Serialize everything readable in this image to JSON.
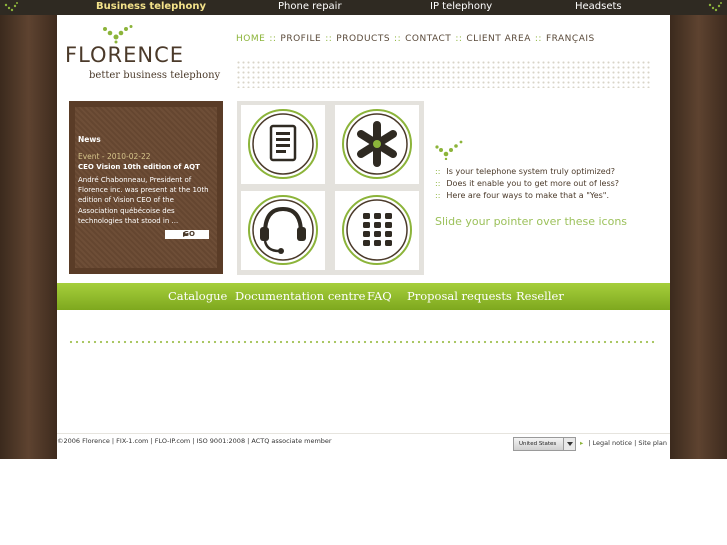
{
  "topbar": {
    "items": [
      "Business telephony",
      "Phone repair",
      "IP telephony",
      "Headsets"
    ]
  },
  "logo": {
    "name": "FLORENCE",
    "tagline": "better business telephony"
  },
  "nav": {
    "items": [
      "HOME",
      "PROFILE",
      "PRODUCTS",
      "CONTACT",
      "CLIENT AREA",
      "FRANÇAIS"
    ],
    "separator": "::"
  },
  "news": {
    "heading": "News",
    "event": "Event - 2010-02-22",
    "title": "CEO Vision 10th edition of AQT",
    "body": "André Chabonneau, President of Florence inc. was present at the 10th edition of Vision CEO of the Association québécoise des technologies that stood in ...",
    "go_label": "GO"
  },
  "icons": [
    "document-icon",
    "asterisk-icon",
    "headset-icon",
    "keypad-icon"
  ],
  "promo": {
    "bullet": "::",
    "lines": [
      "Is your telephone system truly optimized?",
      "Does it enable you to get more out of less?",
      "Here are four ways to make that a \"Yes\"."
    ],
    "hint": "Slide your pointer over these icons"
  },
  "greenbar": {
    "items": [
      "Catalogue",
      "Documentation centre",
      "FAQ",
      "Proposal requests",
      "Reseller"
    ]
  },
  "footer": {
    "copyright": "©2006 Florence | FIX-1.com | FLO-IP.com | ISO 9001:2008 | ACTQ associate member",
    "country": "United States",
    "links": "| Legal notice | Site plan"
  },
  "colors": {
    "accent": "#8cb43a",
    "brown": "#4b3a2a",
    "topbar": "#2f2a22"
  }
}
